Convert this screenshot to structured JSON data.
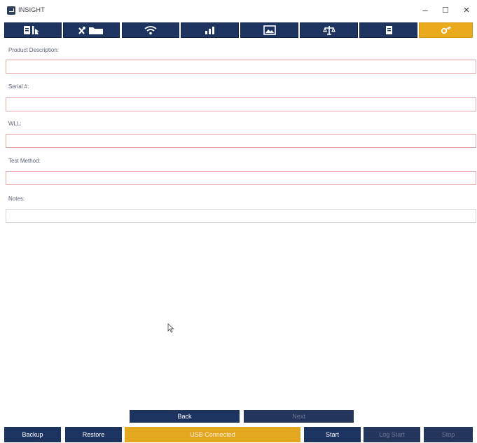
{
  "window": {
    "title": "INSIGHT",
    "minimize_glyph": "–",
    "maximize_glyph": "☐",
    "close_glyph": "×"
  },
  "toolbar": {
    "tabs": [
      {
        "icon": "device-info-icon",
        "active": false
      },
      {
        "icon": "tools-folder-icon",
        "active": false
      },
      {
        "icon": "wifi-icon",
        "active": false
      },
      {
        "icon": "bar-chart-icon",
        "active": false
      },
      {
        "icon": "image-icon",
        "active": false
      },
      {
        "icon": "balance-scale-icon",
        "active": false
      },
      {
        "icon": "document-icon",
        "active": false
      },
      {
        "icon": "key-icon",
        "active": true
      }
    ]
  },
  "form": {
    "product_description": {
      "label": "Product Description:",
      "value": ""
    },
    "serial": {
      "label": "Serial #:",
      "value": ""
    },
    "wll": {
      "label": "WLL:",
      "value": ""
    },
    "test_method": {
      "label": "Test Method:",
      "value": ""
    },
    "notes": {
      "label": "Notes:",
      "value": ""
    }
  },
  "navigation": {
    "back_label": "Back",
    "next_label": "Next"
  },
  "bottom_bar": {
    "backup_label": "Backup",
    "restore_label": "Restore",
    "usb_status": "USB Connected",
    "start_label": "Start",
    "log_start_label": "Log Start",
    "stop_label": "Stop"
  },
  "colors": {
    "primary_navy": "#1d3360",
    "accent_gold": "#e9aa1d",
    "field_error_border": "#e7a7a6"
  }
}
